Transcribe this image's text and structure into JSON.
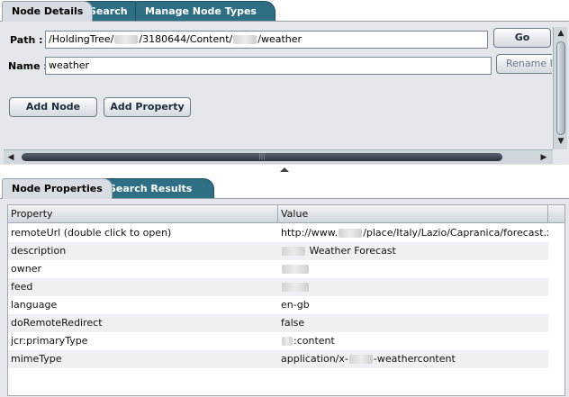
{
  "top_tabs": [
    {
      "label": "Node Details",
      "active": true
    },
    {
      "label": "Search",
      "active": false
    },
    {
      "label": "Manage Node Types",
      "active": false
    }
  ],
  "details": {
    "path_label": "Path :",
    "path_parts": [
      "/HoldingTree/",
      "/3180644/Content/",
      "/weather"
    ],
    "name_label": "Name :",
    "name_value": "weather",
    "go_button": "Go",
    "rename_button": "Rename N",
    "add_node_button": "Add Node",
    "add_property_button": "Add Property"
  },
  "bottom_tabs": [
    {
      "label": "Node Properties",
      "active": true
    },
    {
      "label": "Search Results",
      "active": false
    }
  ],
  "grid": {
    "headers": [
      "Property",
      "Value"
    ],
    "rows": [
      {
        "property": "remoteUrl (double click to open)",
        "value_parts": [
          "http://www.",
          "/place/Italy/Lazio/Capranica/forecast.xml"
        ]
      },
      {
        "property": "description",
        "value_parts": [
          "",
          " Weather Forecast"
        ]
      },
      {
        "property": "owner",
        "value_parts": [
          "",
          ""
        ]
      },
      {
        "property": "feed",
        "value_parts": [
          "",
          ""
        ]
      },
      {
        "property": "language",
        "value_parts": [
          "en-gb"
        ]
      },
      {
        "property": "doRemoteRedirect",
        "value_parts": [
          "false"
        ]
      },
      {
        "property": "jcr:primaryType",
        "value_parts": [
          "",
          ":content"
        ]
      },
      {
        "property": "mimeType",
        "value_parts": [
          "application/x-",
          "-weathercontent"
        ]
      }
    ]
  },
  "icons": {
    "scroll_up": "arrow-up-icon",
    "scroll_down": "arrow-down-icon",
    "scroll_left": "arrow-left-icon",
    "scroll_right": "arrow-right-icon",
    "splitter": "collapse-up-icon"
  }
}
